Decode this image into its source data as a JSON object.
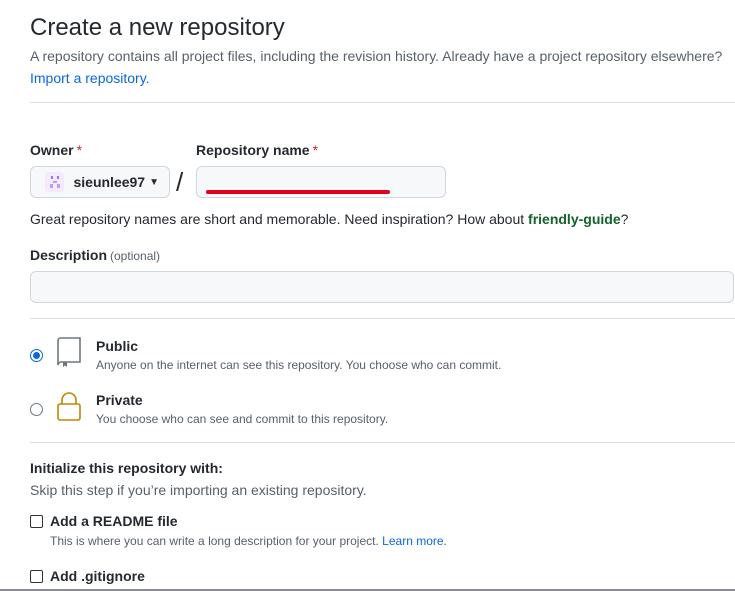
{
  "page": {
    "title": "Create a new repository",
    "intro": "A repository contains all project files, including the revision history. Already have a project repository elsewhere?",
    "import_link": "Import a repository."
  },
  "owner": {
    "label": "Owner",
    "required_mark": "*",
    "selected": "sieunlee97",
    "icon": "caret-down-icon"
  },
  "separator": "/",
  "repo_name": {
    "label": "Repository name",
    "required_mark": "*",
    "value": ""
  },
  "name_hint": {
    "prefix": "Great repository names are short and memorable. Need inspiration? How about ",
    "suggestion": "friendly-guide",
    "suffix": "?"
  },
  "description": {
    "label": "Description",
    "optional": "(optional)",
    "value": ""
  },
  "visibility": {
    "options": [
      {
        "title": "Public",
        "desc": "Anyone on the internet can see this repository. You choose who can commit.",
        "selected": true,
        "icon": "repo-book-icon"
      },
      {
        "title": "Private",
        "desc": "You choose who can see and commit to this repository.",
        "selected": false,
        "icon": "lock-icon"
      }
    ]
  },
  "init": {
    "heading": "Initialize this repository with:",
    "subheading": "Skip this step if you’re importing an existing repository.",
    "readme": {
      "label": "Add a README file",
      "desc": "This is where you can write a long description for your project.",
      "link": "Learn more.",
      "checked": false
    },
    "gitignore": {
      "label": "Add .gitignore",
      "checked": false
    }
  },
  "colors": {
    "accent": "#0969da",
    "danger": "#cf222e",
    "suggestion": "#116329",
    "annotation_red": "#e0001a"
  }
}
